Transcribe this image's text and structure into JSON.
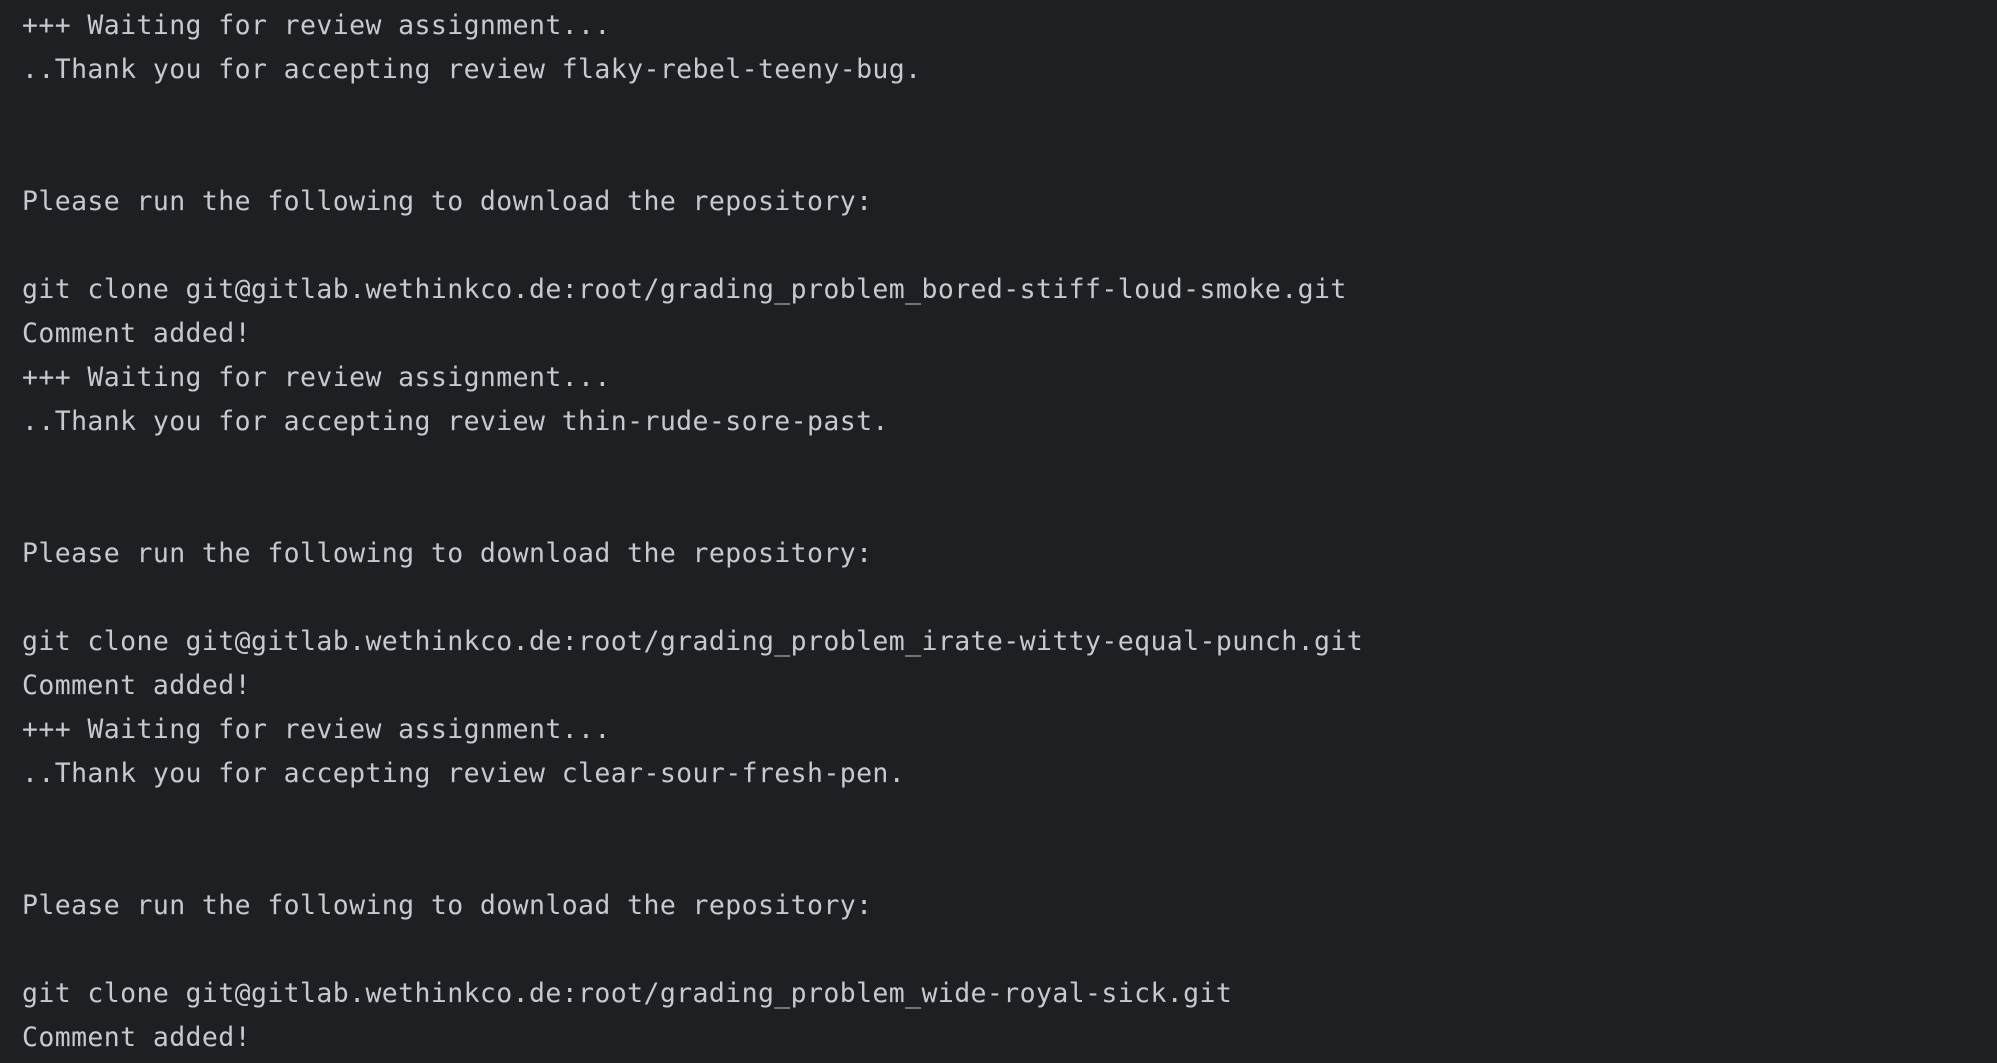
{
  "terminal": {
    "lines": [
      "+++ Waiting for review assignment...",
      "..Thank you for accepting review flaky-rebel-teeny-bug.",
      "",
      "",
      "Please run the following to download the repository:",
      "",
      "git clone git@gitlab.wethinkco.de:root/grading_problem_bored-stiff-loud-smoke.git",
      "Comment added!",
      "+++ Waiting for review assignment...",
      "..Thank you for accepting review thin-rude-sore-past.",
      "",
      "",
      "Please run the following to download the repository:",
      "",
      "git clone git@gitlab.wethinkco.de:root/grading_problem_irate-witty-equal-punch.git",
      "Comment added!",
      "+++ Waiting for review assignment...",
      "..Thank you for accepting review clear-sour-fresh-pen.",
      "",
      "",
      "Please run the following to download the repository:",
      "",
      "git clone git@gitlab.wethinkco.de:root/grading_problem_wide-royal-sick.git",
      "Comment added!"
    ]
  },
  "colors": {
    "background": "#1e1f22",
    "text": "#c7c9cf"
  }
}
